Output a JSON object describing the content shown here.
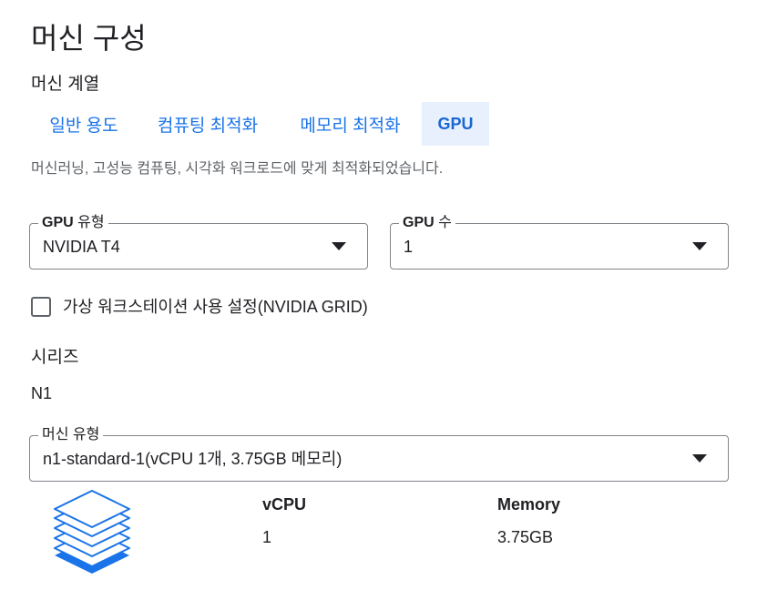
{
  "page_title": "머신 구성",
  "machine_family": {
    "label": "머신 계열",
    "tabs": [
      {
        "label": "일반 용도",
        "active": false
      },
      {
        "label": "컴퓨팅 최적화",
        "active": false
      },
      {
        "label": "메모리 최적화",
        "active": false
      },
      {
        "label": "GPU",
        "active": true
      }
    ],
    "description": "머신러닝, 고성능 컴퓨팅, 시각화 워크로드에 맞게 최적화되었습니다."
  },
  "gpu_type": {
    "label_prefix": "GPU",
    "label_suffix": " 유형",
    "value": "NVIDIA T4",
    "icon": "dropdown-arrow-icon"
  },
  "gpu_count": {
    "label_prefix": "GPU",
    "label_suffix": " 수",
    "value": "1",
    "icon": "dropdown-arrow-icon"
  },
  "virtual_workstation": {
    "label": "가상 워크스테이션 사용 설정(NVIDIA GRID)",
    "checked": false
  },
  "series": {
    "label": "시리즈",
    "value": "N1"
  },
  "machine_type": {
    "label": "머신 유형",
    "value": "n1-standard-1(vCPU 1개, 3.75GB 메모리)",
    "icon": "dropdown-arrow-icon"
  },
  "specs": {
    "icon": "stacked-layers-icon",
    "vcpu_header": "vCPU",
    "vcpu_value": "1",
    "memory_header": "Memory",
    "memory_value": "3.75GB"
  },
  "colors": {
    "accent": "#1a73e8",
    "tab_active_bg": "#e8f0fe",
    "text": "#202124",
    "secondary_text": "#5f6368",
    "border": "#80868b"
  }
}
